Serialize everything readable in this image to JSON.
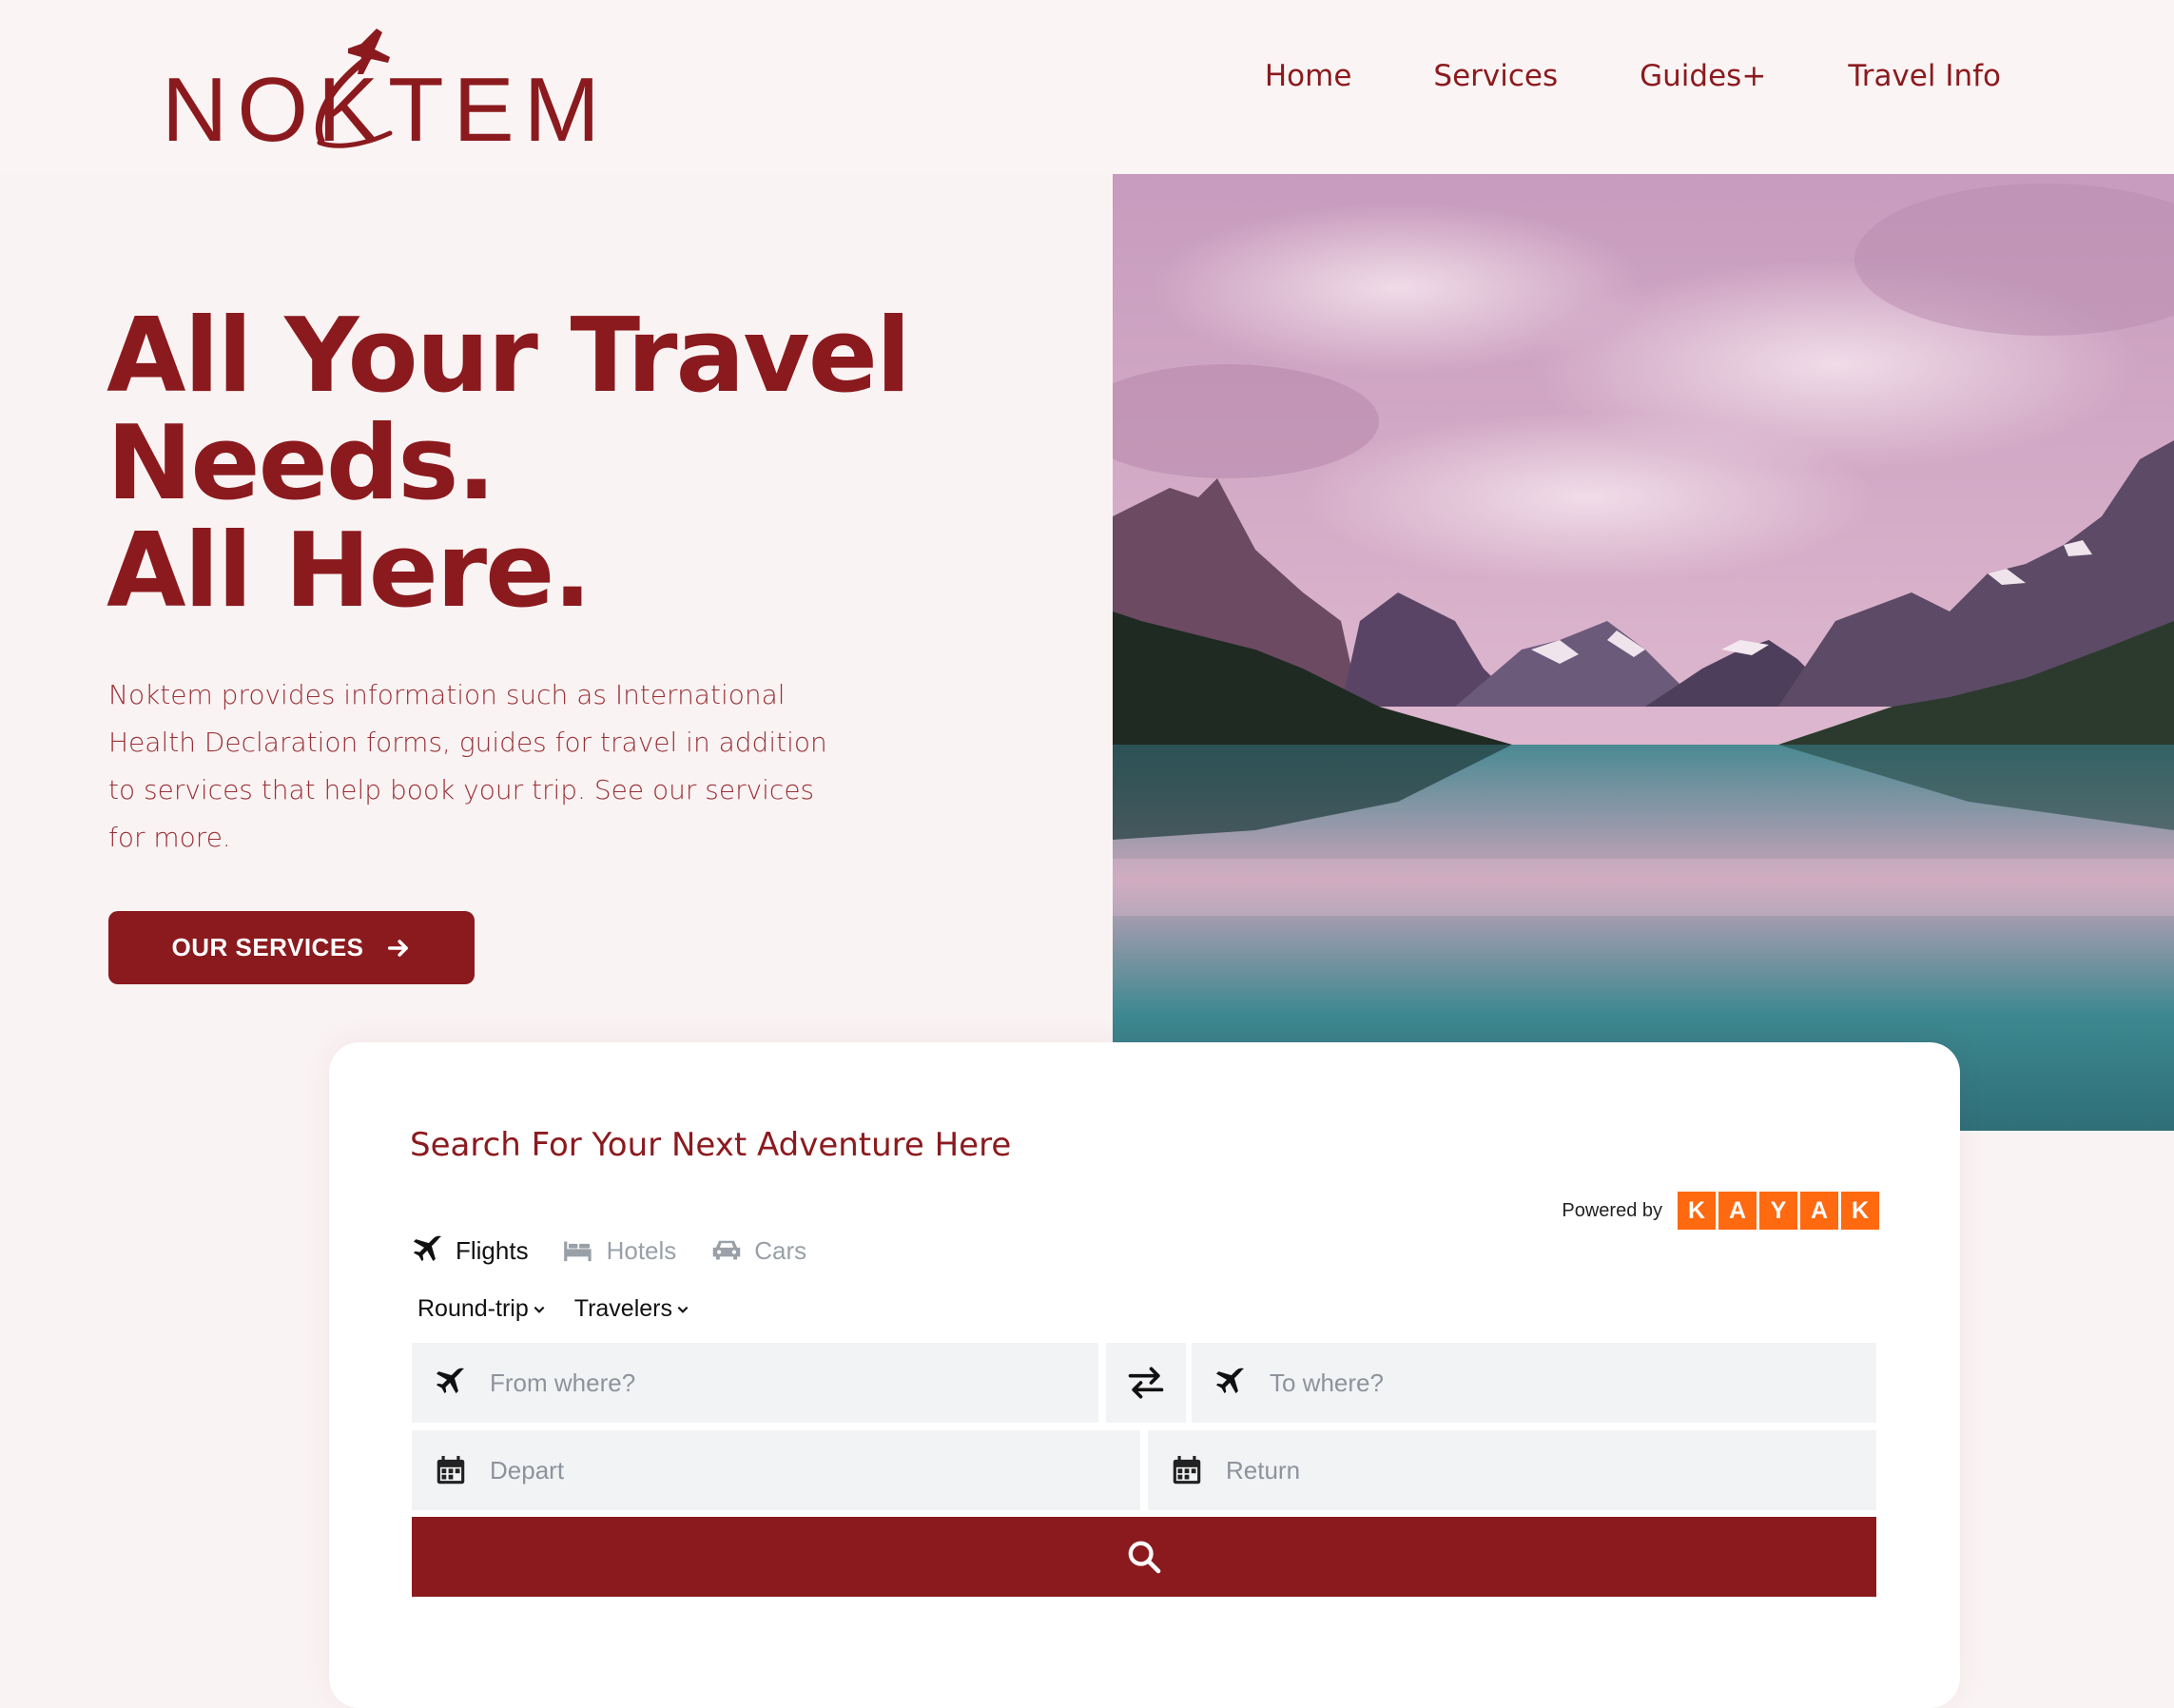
{
  "brand": {
    "name": "NOKTEM"
  },
  "nav": {
    "items": [
      "Home",
      "Services",
      "Guides+",
      "Travel Info"
    ]
  },
  "hero": {
    "title_lines": [
      "All Your Travel",
      "Needs.",
      "All Here."
    ],
    "description": "Noktem provides information such as International Health Declaration forms, guides for travel in addition to services that help book your trip. See our services for more.",
    "cta_label": "OUR SERVICES"
  },
  "search": {
    "title": "Search For Your Next Adventure Here",
    "powered_by": "Powered by",
    "provider_letters": [
      "K",
      "A",
      "Y",
      "A",
      "K"
    ],
    "tabs": [
      {
        "label": "Flights",
        "icon": "plane-icon",
        "active": true
      },
      {
        "label": "Hotels",
        "icon": "bed-icon",
        "active": false
      },
      {
        "label": "Cars",
        "icon": "car-icon",
        "active": false
      }
    ],
    "trip_type": "Round-trip",
    "travelers": "Travelers",
    "from_placeholder": "From where?",
    "to_placeholder": "To where?",
    "depart_placeholder": "Depart",
    "return_placeholder": "Return"
  },
  "colors": {
    "brand": "#8b1a1e",
    "background": "#faf3f3",
    "kayak": "#ff690f",
    "field": "#f2f3f5"
  }
}
